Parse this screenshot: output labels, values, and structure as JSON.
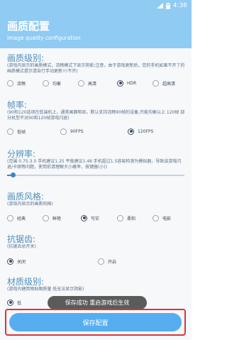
{
  "status": {
    "time": "4:36"
  },
  "header": {
    "title": "画质配置",
    "subtitle": "Image quality configuration"
  },
  "sections": {
    "quality": {
      "title": "画质级别:",
      "desc": "(游戏内显示的画质模式，流畅模式下显示阴影;注意，由于游戏更新后，您的手机如果不开了的画质模式提示请自行手动更新!!!不开)",
      "options": [
        "流畅",
        "均衡",
        "高清",
        "HDR",
        "超高清"
      ],
      "selected": "HDR"
    },
    "fps": {
      "title": "帧率:",
      "desc": "(90和120选项在低端机上，通常画面明显。默认支持流畅90帧的设备,只能均衡以上 120帧 部分机型不对90和120帧游戏闪退)",
      "options": [
        "低帧",
        "90FPS",
        "120FPS"
      ],
      "selected": "120FPS"
    },
    "resolution": {
      "title": "分辨率:",
      "desc": "(范围 0.75-3.0 手机建议1.25 平板建议1.48 手机超过1.5容易检测为模拟器，导致该游戏闪退/卡顿等问题，使用前请理解大小概率，按键器(小))",
      "value_fraction": 0.02
    },
    "style": {
      "title": "画质风格:",
      "desc": "(游戏内显示的画质风格)",
      "options": [
        "经典",
        "鲜艳",
        "写实",
        "柔和",
        "电影"
      ],
      "selected": "写实"
    },
    "aa": {
      "title": "抗锯齿:",
      "desc": "(抗锯齿总开关)",
      "options": [
        "关闭",
        "开启"
      ],
      "selected": "关闭"
    },
    "material": {
      "title": "材质级别:",
      "desc": "(游戏内建筑物贴图质量 低无法显示阴影)",
      "options": [
        "低"
      ],
      "selected": "低"
    }
  },
  "toast": "保存成功 重启游戏后生效",
  "save_button": "保存配置",
  "colors": {
    "header_bg": "#8fcbf3",
    "title_accent": "#4f8fbd",
    "button": "#56aef0",
    "highlight_border": "#e0323a"
  }
}
